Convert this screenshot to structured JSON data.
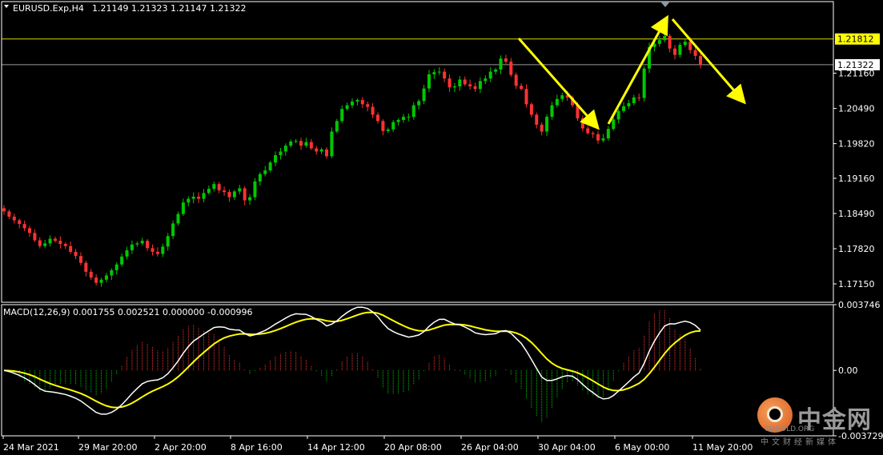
{
  "header": {
    "symbol": "EURUSD.Exp,H4",
    "ohlc": "1.21149 1.21323 1.21147 1.21322"
  },
  "macd_header": "MACD(12,26,9) 0.001755 0.002521 0.000000 -0.000996",
  "watermark": {
    "brand_cn": "中金网",
    "brand_en": "CNGOLD.ORG",
    "tagline": "中文财经新媒体"
  },
  "colors": {
    "background": "#000000",
    "bull": "#00c800",
    "bear": "#ff3232",
    "macd_line": "#ffffff",
    "signal_line": "#ffff00",
    "histogram_pos": "#ff3232",
    "histogram_neg": "#00c800",
    "grid": "#ffffff",
    "arrows": "#ffff00"
  },
  "chart_data": [
    {
      "type": "candlestick",
      "title": "EURUSD.Exp,H4",
      "y_axis_ticks": [
        "1.21160",
        "1.20490",
        "1.19820",
        "1.19160",
        "1.18490",
        "1.17820",
        "1.17150"
      ],
      "ylim": [
        1.168,
        1.2228
      ],
      "price_tags": [
        {
          "label": "1.21812",
          "value": 1.21812,
          "style": "high"
        },
        {
          "label": "1.21322",
          "value": 1.21322,
          "style": "last"
        }
      ],
      "x_ticks": [
        "24 Mar 2021",
        "29 Mar 20:00",
        "2 Apr 20:00",
        "8 Apr 16:00",
        "14 Apr 12:00",
        "20 Apr 08:00",
        "26 Apr 04:00",
        "30 Apr 04:00",
        "6 May 00:00",
        "11 May 20:00"
      ],
      "closes": [
        1.1853,
        1.1843,
        1.1836,
        1.1829,
        1.1821,
        1.1812,
        1.1798,
        1.1787,
        1.1792,
        1.1801,
        1.1797,
        1.1791,
        1.1787,
        1.1776,
        1.1768,
        1.1755,
        1.1738,
        1.1727,
        1.1717,
        1.1723,
        1.1731,
        1.1741,
        1.1752,
        1.1767,
        1.1779,
        1.179,
        1.1792,
        1.1797,
        1.1783,
        1.1776,
        1.1772,
        1.1786,
        1.1806,
        1.183,
        1.1848,
        1.187,
        1.1877,
        1.1881,
        1.1877,
        1.1888,
        1.1896,
        1.1905,
        1.1893,
        1.189,
        1.188,
        1.1891,
        1.1897,
        1.1874,
        1.188,
        1.191,
        1.1924,
        1.1931,
        1.1946,
        1.196,
        1.1967,
        1.1978,
        1.1986,
        1.1987,
        1.1978,
        1.1985,
        1.1973,
        1.1967,
        1.1971,
        1.1958,
        1.2005,
        1.2025,
        1.2048,
        1.2055,
        1.2062,
        1.2065,
        1.2057,
        1.2052,
        1.2037,
        1.2025,
        1.2006,
        1.2009,
        1.2023,
        1.2027,
        1.2033,
        1.2033,
        1.2055,
        1.2063,
        1.2087,
        1.2114,
        1.2118,
        1.2119,
        1.2106,
        1.2089,
        1.2091,
        1.2104,
        1.2095,
        1.2091,
        1.2086,
        1.2101,
        1.2106,
        1.2119,
        1.2123,
        1.2144,
        1.2138,
        1.2113,
        1.2092,
        1.2086,
        1.2057,
        1.2037,
        1.2018,
        1.2005,
        1.2033,
        1.2055,
        1.2067,
        1.2074,
        1.207,
        1.2055,
        1.203,
        1.2011,
        1.2002,
        1.2,
        1.1988,
        1.1992,
        1.201,
        1.2028,
        1.2044,
        1.2053,
        1.2059,
        1.207,
        1.2069,
        1.2125,
        1.2166,
        1.2172,
        1.2179,
        1.2187,
        1.2163,
        1.2151,
        1.217,
        1.2176,
        1.216,
        1.2149,
        1.2132
      ]
    },
    {
      "type": "macd",
      "title": "MACD(12,26,9)",
      "params": [
        12,
        26,
        9
      ],
      "values": {
        "macd": 0.001755,
        "signal": 0.002521,
        "histogram_scale": 0.0,
        "last": -0.000996
      },
      "y_axis_ticks": [
        "0.003746",
        "0.00",
        "-0.003729"
      ],
      "ylim": [
        -0.003729,
        0.003746
      ]
    }
  ]
}
